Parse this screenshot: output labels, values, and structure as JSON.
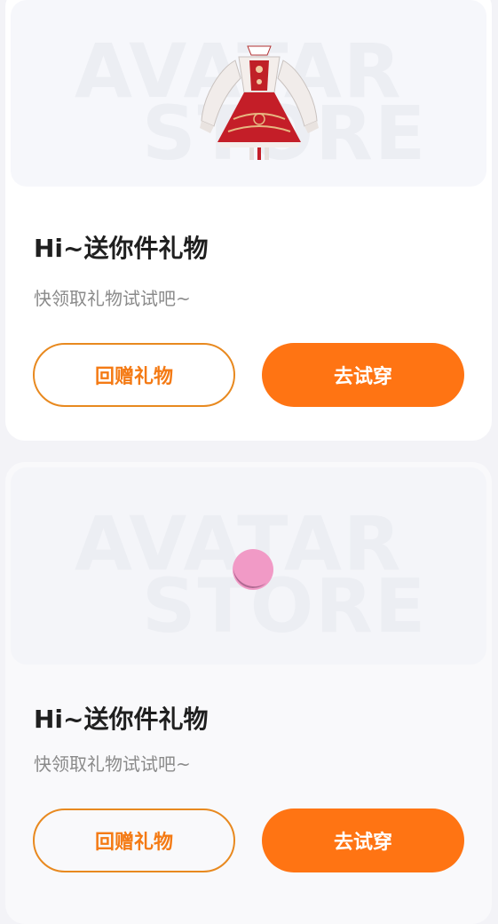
{
  "cards": [
    {
      "banner": {
        "watermark_top": "AVATAR",
        "watermark_bottom": "STORE",
        "image": "red-dress-image"
      },
      "title": "Hi~送你件礼物",
      "subtitle": "快领取礼物试试吧~",
      "return_gift_label": "回赠礼物",
      "try_on_label": "去试穿"
    },
    {
      "banner": {
        "watermark_top": "AVATAR",
        "watermark_bottom": "STORE",
        "image": "loading-spinner"
      },
      "title": "Hi~送你件礼物",
      "subtitle": "快领取礼物试试吧~",
      "return_gift_label": "回赠礼物",
      "try_on_label": "去试穿"
    }
  ],
  "colors": {
    "accent": "#ff7413",
    "outline": "#e8891f",
    "title": "#1f1f1f",
    "subtitle": "#8a8a8a"
  }
}
